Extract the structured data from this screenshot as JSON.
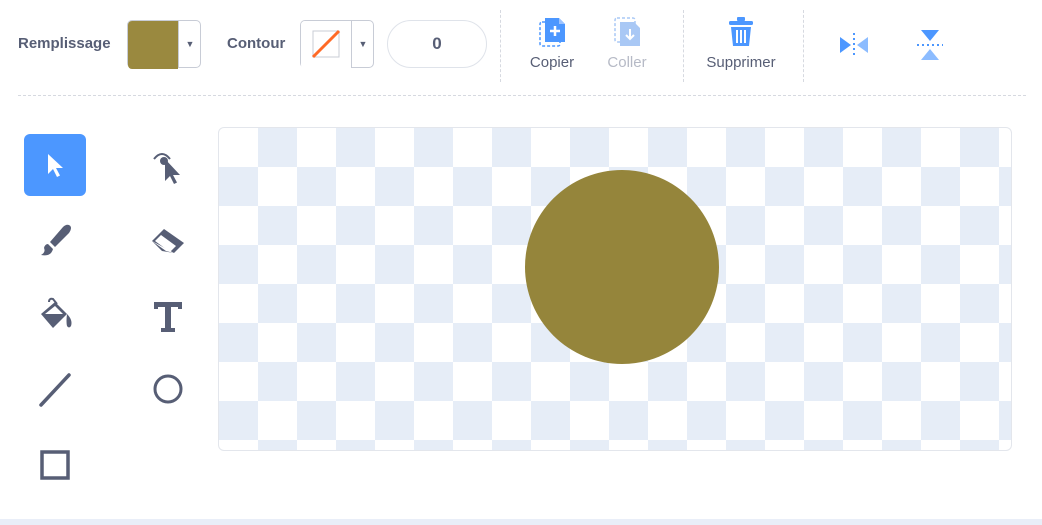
{
  "toolbar": {
    "fill_label": "Remplissage",
    "fill_color": "#9a893f",
    "outline_label": "Contour",
    "outline_value": "0",
    "copy_label": "Copier",
    "paste_label": "Coller",
    "delete_label": "Supprimer"
  },
  "tools": [
    {
      "name": "select-tool",
      "icon": "arrow-cursor-icon",
      "selected": true
    },
    {
      "name": "reshape-tool",
      "icon": "reshape-icon",
      "selected": false
    },
    {
      "name": "brush-tool",
      "icon": "brush-icon",
      "selected": false
    },
    {
      "name": "eraser-tool",
      "icon": "eraser-icon",
      "selected": false
    },
    {
      "name": "fill-tool",
      "icon": "paint-bucket-icon",
      "selected": false
    },
    {
      "name": "text-tool",
      "icon": "text-icon",
      "selected": false
    },
    {
      "name": "line-tool",
      "icon": "line-icon",
      "selected": false
    },
    {
      "name": "circle-tool",
      "icon": "circle-icon",
      "selected": false
    },
    {
      "name": "rectangle-tool",
      "icon": "rectangle-icon",
      "selected": false
    }
  ],
  "canvas": {
    "shape": "circle",
    "shape_color": "#95853b",
    "checker_color": "#e6edf7"
  },
  "colors": {
    "accent": "#4c97ff",
    "text": "#575e75"
  }
}
